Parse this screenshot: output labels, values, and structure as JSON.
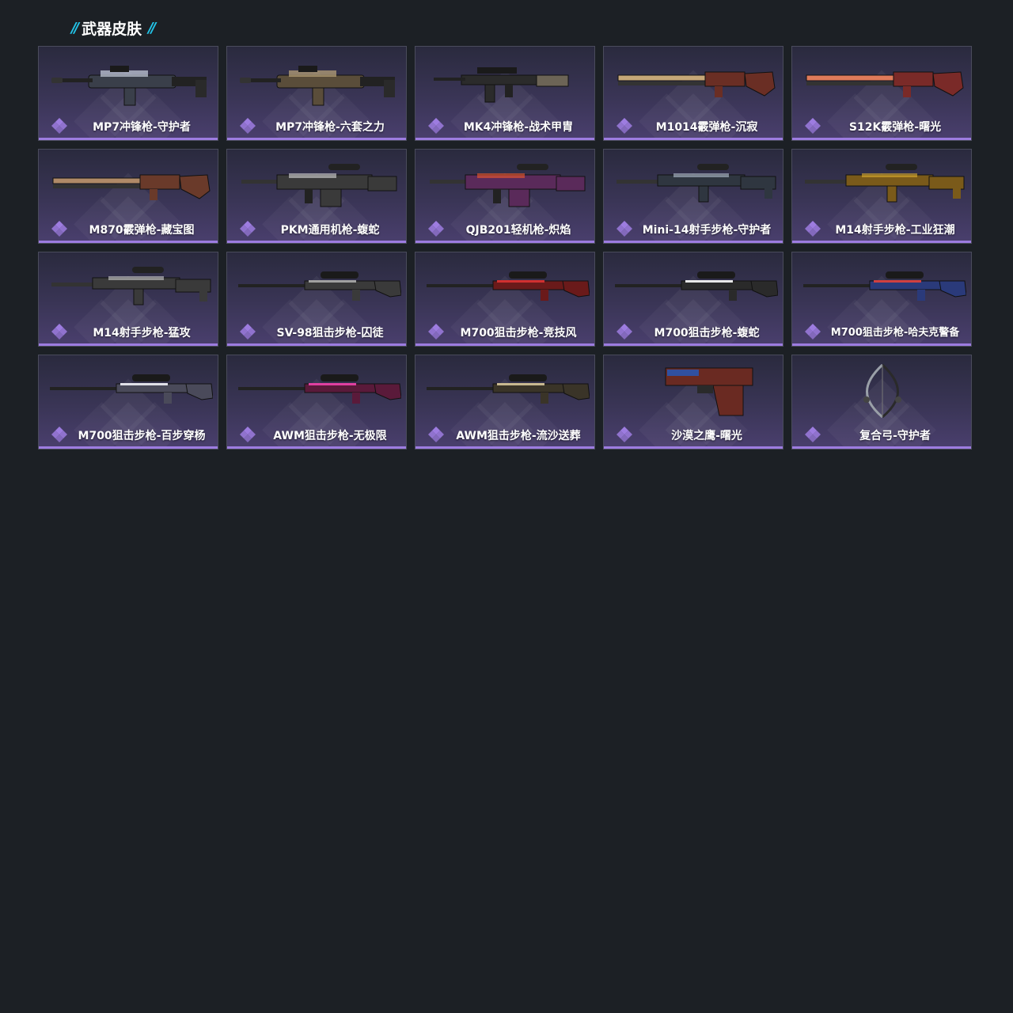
{
  "section": {
    "title": "武器皮肤",
    "accent": "#22c4e8"
  },
  "colors": {
    "card_border": "#4a4b5c",
    "card_bottom_bar": "#9d7ce0",
    "badge": "#9d7ce0",
    "page_background": "#1c2025"
  },
  "skins": [
    {
      "name": "MP7冲锋枪-守护者",
      "icon": "smg-icon",
      "primary": "#3a3f4a",
      "accent": "#c9d2e0"
    },
    {
      "name": "MP7冲锋枪-六套之力",
      "icon": "smg-icon",
      "primary": "#5a4d3a",
      "accent": "#bda67a"
    },
    {
      "name": "MK4冲锋枪-战术甲胄",
      "icon": "assault-rifle-icon",
      "primary": "#2b2b2b",
      "accent": "#6c6456"
    },
    {
      "name": "M1014霰弹枪-沉寂",
      "icon": "shotgun-icon",
      "primary": "#6a2e24",
      "accent": "#c6a778"
    },
    {
      "name": "S12K霰弹枪-曙光",
      "icon": "shotgun-icon",
      "primary": "#7a2a28",
      "accent": "#e07a5a"
    },
    {
      "name": "M870霰弹枪-藏宝图",
      "icon": "shotgun-icon",
      "primary": "#6a3a2a",
      "accent": "#b08a68"
    },
    {
      "name": "PKM通用机枪-蝮蛇",
      "icon": "machine-gun-icon",
      "primary": "#3a3a3a",
      "accent": "#d8d8d8"
    },
    {
      "name": "QJB201轻机枪-炽焰",
      "icon": "machine-gun-icon",
      "primary": "#5a2a5a",
      "accent": "#f05a2a"
    },
    {
      "name": "Mini-14射手步枪-守护者",
      "icon": "marksman-rifle-icon",
      "primary": "#2f3640",
      "accent": "#b8c4d4"
    },
    {
      "name": "M14射手步枪-工业狂潮",
      "icon": "marksman-rifle-icon",
      "primary": "#7a5a1a",
      "accent": "#e0b030"
    },
    {
      "name": "M14射手步枪-猛攻",
      "icon": "marksman-rifle-icon",
      "primary": "#3a3a3a",
      "accent": "#d0d0d0"
    },
    {
      "name": "SV-98狙击步枪-囚徒",
      "icon": "sniper-rifle-icon",
      "primary": "#3a3a3a",
      "accent": "#a0a0a0"
    },
    {
      "name": "M700狙击步枪-竞技风",
      "icon": "sniper-rifle-icon",
      "primary": "#6a1a1a",
      "accent": "#d03030"
    },
    {
      "name": "M700狙击步枪-蝮蛇",
      "icon": "sniper-rifle-icon",
      "primary": "#2a2a2a",
      "accent": "#e8e8e8"
    },
    {
      "name": "M700狙击步枪-哈夫克警备",
      "icon": "sniper-rifle-icon",
      "primary": "#2a3a7a",
      "accent": "#d04040",
      "small": true
    },
    {
      "name": "M700狙击步枪-百步穿杨",
      "icon": "sniper-rifle-icon",
      "primary": "#4a4a5a",
      "accent": "#e0e0e8"
    },
    {
      "name": "AWM狙击步枪-无极限",
      "icon": "sniper-rifle-icon",
      "primary": "#5a1a3a",
      "accent": "#e040a0"
    },
    {
      "name": "AWM狙击步枪-流沙送葬",
      "icon": "sniper-rifle-icon",
      "primary": "#3a3428",
      "accent": "#c8b890"
    },
    {
      "name": "沙漠之鹰-曙光",
      "icon": "pistol-icon",
      "primary": "#6a2a22",
      "accent": "#3050a0"
    },
    {
      "name": "复合弓-守护者",
      "icon": "compound-bow-icon",
      "primary": "#2a2a2a",
      "accent": "#9aa0a8"
    }
  ]
}
